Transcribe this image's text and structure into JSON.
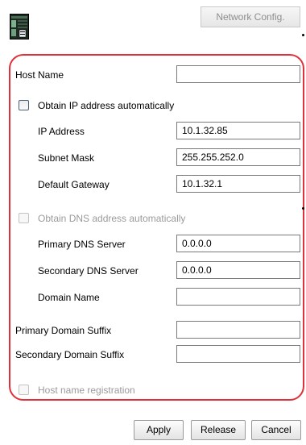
{
  "toolbar": {
    "device_icon": "server-device-icon",
    "network_config_label": "Network Config."
  },
  "form": {
    "host_name": {
      "label": "Host Name",
      "value": ""
    },
    "obtain_ip": {
      "label": "Obtain IP address automatically",
      "checked": false,
      "enabled": true
    },
    "ip_address": {
      "label": "IP Address",
      "value": "10.1.32.85"
    },
    "subnet_mask": {
      "label": "Subnet Mask",
      "value": "255.255.252.0"
    },
    "default_gateway": {
      "label": "Default Gateway",
      "value": "10.1.32.1"
    },
    "obtain_dns": {
      "label": "Obtain DNS address automatically",
      "checked": false,
      "enabled": false
    },
    "primary_dns": {
      "label": "Primary DNS Server",
      "value": "0.0.0.0"
    },
    "secondary_dns": {
      "label": "Secondary DNS Server",
      "value": "0.0.0.0"
    },
    "domain_name": {
      "label": "Domain Name",
      "value": ""
    },
    "primary_domain_suffix": {
      "label": "Primary Domain Suffix",
      "value": ""
    },
    "secondary_domain_suffix": {
      "label": "Secondary Domain Suffix",
      "value": ""
    },
    "host_name_registration": {
      "label": "Host name registration",
      "checked": false,
      "enabled": false
    }
  },
  "buttons": {
    "apply": "Apply",
    "release": "Release",
    "cancel": "Cancel"
  },
  "colors": {
    "highlight_border": "#e0303a",
    "disabled_text": "#9a9a9a"
  }
}
